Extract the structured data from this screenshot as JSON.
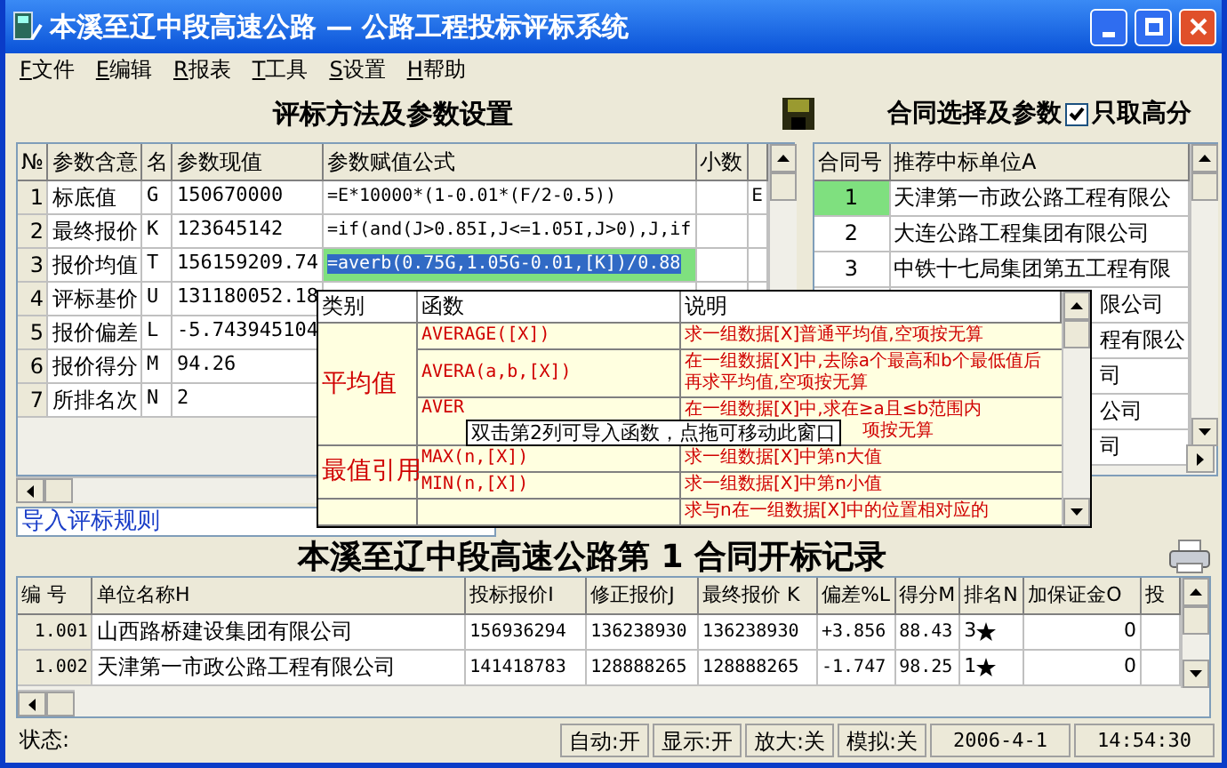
{
  "window": {
    "title": "本溪至辽中段高速公路 — 公路工程投标评标系统"
  },
  "menu": [
    {
      "key": "F",
      "label": "文件"
    },
    {
      "key": "E",
      "label": "编辑"
    },
    {
      "key": "R",
      "label": "报表"
    },
    {
      "key": "T",
      "label": "工具"
    },
    {
      "key": "S",
      "label": "设置"
    },
    {
      "key": "H",
      "label": "帮助"
    }
  ],
  "params": {
    "title": "评标方法及参数设置",
    "columns": [
      "№",
      "参数含意",
      "名",
      "参数现值",
      "参数赋值公式",
      "小数"
    ],
    "rows": [
      {
        "no": "1",
        "meaning": "标底值",
        "name": "G",
        "value": "150670000",
        "formula": "=E*10000*(1-0.01*(F/2-0.5))",
        "column_7": "E",
        "selected": false
      },
      {
        "no": "2",
        "meaning": "最终报价",
        "name": "K",
        "value": "123645142",
        "formula": "=if(and(J>0.85I,J<=1.05I,J>0),J,if",
        "selected": false
      },
      {
        "no": "3",
        "meaning": "报价均值",
        "name": "T",
        "value": "156159209.74",
        "formula": "=averb(0.75G,1.05G-0.01,[K])/0.88",
        "selected": true
      },
      {
        "no": "4",
        "meaning": "评标基价",
        "name": "U",
        "value": "131180052.18"
      },
      {
        "no": "5",
        "meaning": "报价偏差",
        "name": "L",
        "value": "-5.743945104"
      },
      {
        "no": "6",
        "meaning": "报价得分",
        "name": "M",
        "value": "94.26"
      },
      {
        "no": "7",
        "meaning": "所排名次",
        "name": "N",
        "value": "2"
      }
    ]
  },
  "import_rules": "导入评标规则",
  "contracts": {
    "title": "合同选择及参数",
    "high_only": {
      "label": "只取高分",
      "checked": true
    },
    "columns": [
      "合同号",
      "推荐中标单位A"
    ],
    "rows": [
      {
        "no": "1",
        "unit": "天津第一市政公路工程有限公",
        "selected": true
      },
      {
        "no": "2",
        "unit": "大连公路工程集团有限公司",
        "selected": false
      },
      {
        "no": "3",
        "unit": "中铁十七局集团第五工程有限",
        "selected": false
      },
      {
        "unit": "限公司"
      },
      {
        "unit": "程有限公"
      },
      {
        "unit": "司"
      },
      {
        "unit": "公司"
      },
      {
        "unit": "司"
      }
    ]
  },
  "function_popup": {
    "columns": [
      "类别",
      "函数",
      "说明"
    ],
    "groups": [
      {
        "category": "平均值",
        "functions": [
          {
            "name": "AVERAGE([X])",
            "desc": "求一组数据[X]普通平均值,空项按无算"
          },
          {
            "name": "AVERA(a,b,[X])",
            "desc": "在一组数据[X]中,去除a个最高和b个最低值后再求平均值,空项按无算"
          },
          {
            "name": "AVER",
            "desc": "在一组数据[X]中,求在≥a且≤b范围内",
            "desc_tail": "项按无算"
          }
        ]
      },
      {
        "category": "最值引用",
        "functions": [
          {
            "name": "MAX(n,[X])",
            "desc": "求一组数据[X]中第n大值"
          },
          {
            "name": "MIN(n,[X])",
            "desc": "求一组数据[X]中第n小值"
          }
        ]
      },
      {
        "functions": [
          {
            "desc": "求与n在一组数据[X]中的位置相对应的"
          }
        ]
      }
    ]
  },
  "tooltip": "双击第2列可导入函数，点拖可移动此窗口",
  "records": {
    "title": "本溪至辽中段高速公路第 1 合同开标记录",
    "columns": [
      "编 号",
      "单位名称H",
      "投标报价I",
      "修正报价J",
      "最终报价 K",
      "偏差%L",
      "得分M",
      "排名N",
      "加保证金O",
      "投"
    ],
    "rows": [
      {
        "no": "1.001",
        "unit": "山西路桥建设集团有限公司",
        "bid": "156936294",
        "corrected": "136238930",
        "final": "136238930",
        "deviation": "+3.856",
        "score": "88.43",
        "rank": "3",
        "star": true,
        "deposit": "0"
      },
      {
        "no": "1.002",
        "unit": "天津第一市政公路工程有限公司",
        "bid": "141418783",
        "corrected": "128888265",
        "final": "128888265",
        "deviation": "-1.747",
        "score": "98.25",
        "rank": "1",
        "star": true,
        "deposit": "0"
      }
    ]
  },
  "status_bar": [
    "状态:",
    "自动:开",
    "显示:开",
    "放大:关",
    "模拟:关",
    "2006-4-1",
    "14:54:30"
  ]
}
